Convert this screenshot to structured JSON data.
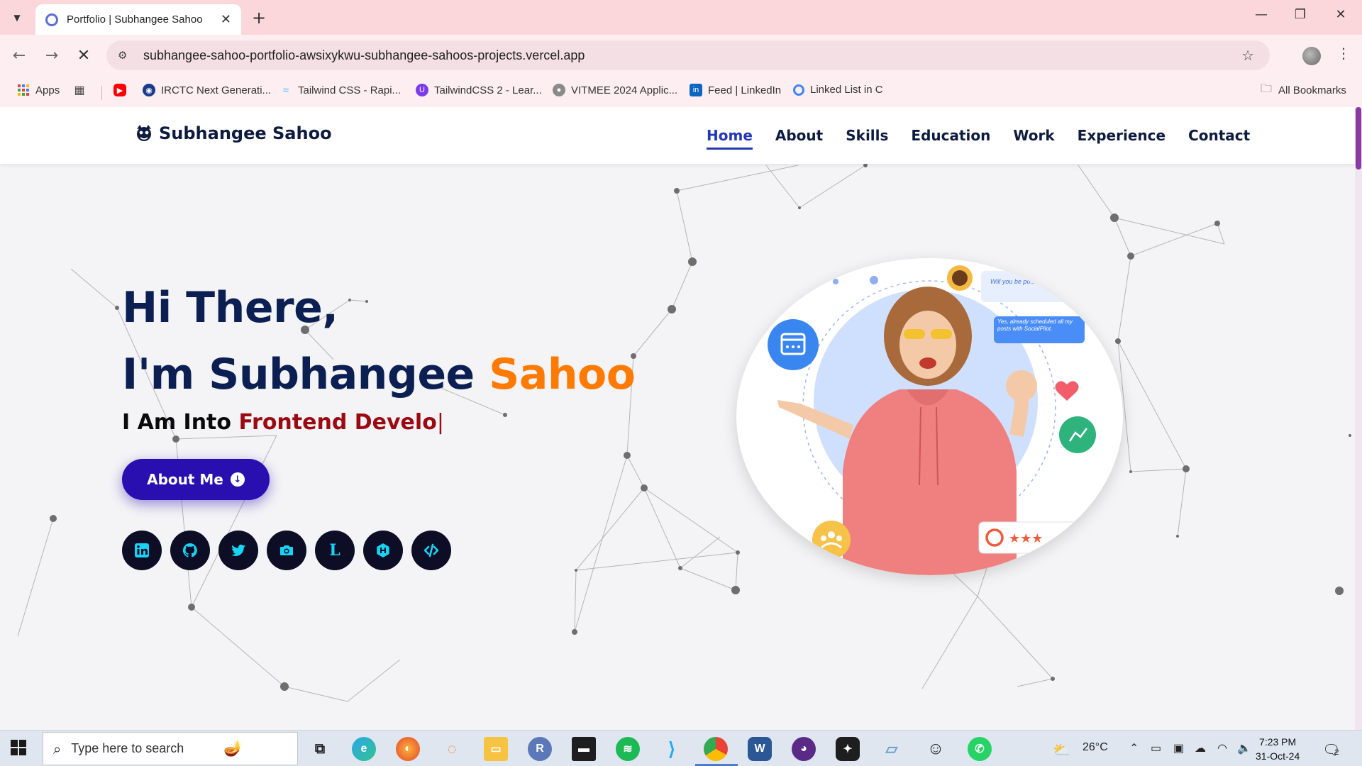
{
  "browser": {
    "tab_title": "Portfolio | Subhangee Sahoo",
    "url": "subhangee-sahoo-portfolio-awsixykwu-subhangee-sahoos-projects.vercel.app",
    "bookmarks": [
      {
        "label": "Apps"
      },
      {
        "label": ""
      },
      {
        "label": ""
      },
      {
        "label": "IRCTC Next Generati..."
      },
      {
        "label": "Tailwind CSS - Rapi..."
      },
      {
        "label": "TailwindCSS 2 - Lear..."
      },
      {
        "label": "VITMEE 2024 Applic..."
      },
      {
        "label": "Feed | LinkedIn"
      },
      {
        "label": "Linked List in C"
      }
    ],
    "all_bookmarks": "All Bookmarks"
  },
  "site": {
    "brand": "Subhangee Sahoo",
    "nav": [
      {
        "label": "Home",
        "active": true
      },
      {
        "label": "About"
      },
      {
        "label": "Skills"
      },
      {
        "label": "Education"
      },
      {
        "label": "Work"
      },
      {
        "label": "Experience"
      },
      {
        "label": "Contact"
      }
    ],
    "hero": {
      "greeting": "Hi There,",
      "intro_prefix": "I'm Subhangee",
      "intro_accent": "Sahoo",
      "typed_prefix": "I Am Into",
      "typed_role": "Frontend Develo",
      "caret": "|",
      "button_label": "About Me",
      "socials": [
        "linkedin-icon",
        "github-icon",
        "twitter-icon",
        "camera-icon",
        "leetcode-icon",
        "hashnode-icon",
        "code-icon"
      ],
      "social_glyphs": {
        "leetcode": "L"
      },
      "illustration": {
        "chat_question": "Will you be po... weekend?",
        "chat_answer": "Yes, already scheduled all my posts with SocialPilot."
      }
    }
  },
  "taskbar": {
    "search_placeholder": "Type here to search",
    "weather": "26°C",
    "time": "7:23 PM",
    "date": "31-Oct-24",
    "notifications": "2"
  },
  "colors": {
    "accent": "#ff7a00",
    "primary": "#2a0fb0",
    "heading": "#0c1f52",
    "role": "#9b0a12",
    "social_bg": "#0d0d26",
    "social_icon": "#19d3f5",
    "tabbar": "#fbd7dc"
  }
}
